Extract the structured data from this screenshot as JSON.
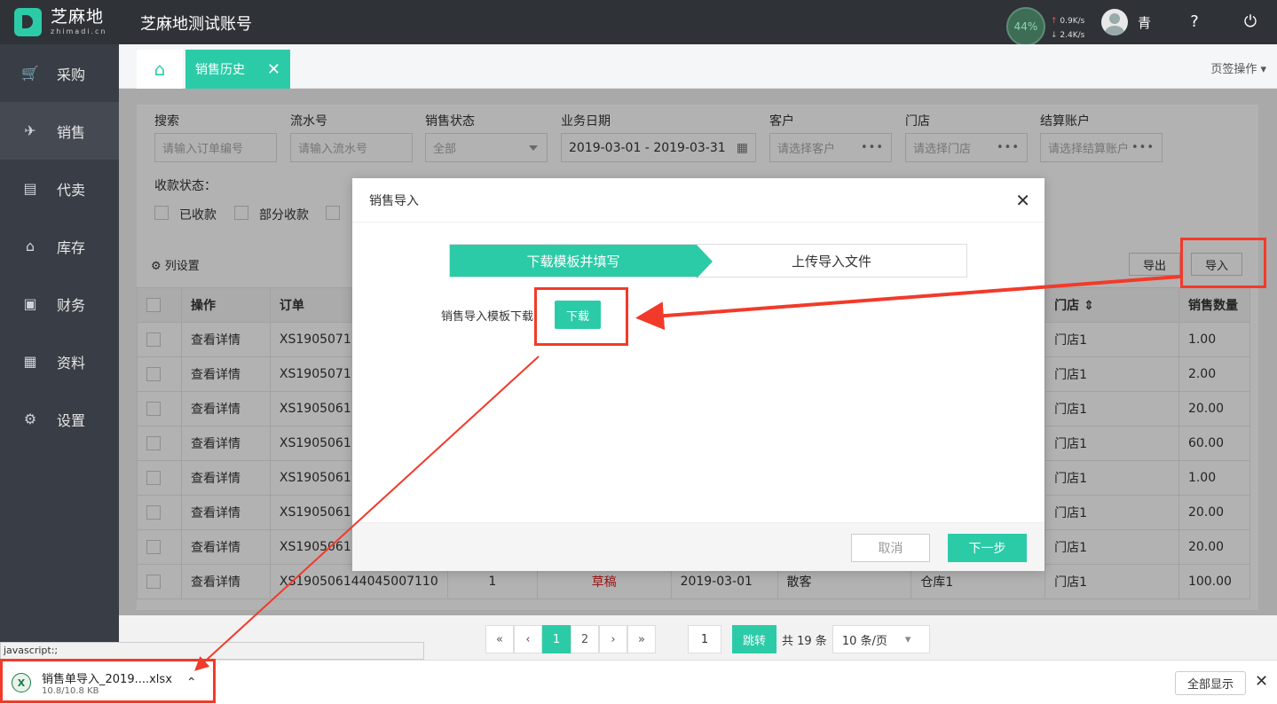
{
  "header": {
    "logo_cn": "芝麻地",
    "logo_en": "zhimadi.cn",
    "account": "芝麻地测试账号",
    "cpu": "44%",
    "up": "0.9K/s",
    "down": "2.4K/s",
    "user": "青"
  },
  "sidebar": {
    "items": [
      {
        "label": "采购",
        "icon": "cart-icon"
      },
      {
        "label": "销售",
        "icon": "sale-icon"
      },
      {
        "label": "代卖",
        "icon": "consign-icon"
      },
      {
        "label": "库存",
        "icon": "warehouse-icon"
      },
      {
        "label": "财务",
        "icon": "finance-icon"
      },
      {
        "label": "资料",
        "icon": "data-icon"
      },
      {
        "label": "设置",
        "icon": "gear-icon"
      }
    ]
  },
  "tabs": {
    "active": "销售历史",
    "ops": "页签操作"
  },
  "filters": {
    "search_label": "搜索",
    "search_ph": "请输入订单编号",
    "serial_label": "流水号",
    "serial_ph": "请输入流水号",
    "status_label": "销售状态",
    "status_val": "全部",
    "date_label": "业务日期",
    "date_val": "2019-03-01 - 2019-03-31",
    "customer_label": "客户",
    "customer_ph": "请选择客户",
    "store_label": "门店",
    "store_ph": "请选择门店",
    "account_label": "结算账户",
    "account_ph": "请选择结算账户",
    "pay_label": "收款状态：",
    "pay_opt1": "已收款",
    "pay_opt2": "部分收款"
  },
  "toolbar": {
    "col_settings": "列设置",
    "export": "导出",
    "import": "导入"
  },
  "table": {
    "headers": {
      "op": "操作",
      "order": "订单",
      "store": "门店",
      "qty": "销售数量"
    },
    "rows": [
      {
        "op": "查看详情",
        "order": "XS1905071",
        "store": "门店1",
        "qty": "1.00"
      },
      {
        "op": "查看详情",
        "order": "XS1905071",
        "store": "门店1",
        "qty": "2.00"
      },
      {
        "op": "查看详情",
        "order": "XS1905061",
        "store": "门店1",
        "qty": "20.00"
      },
      {
        "op": "查看详情",
        "order": "XS1905061",
        "store": "门店1",
        "qty": "60.00"
      },
      {
        "op": "查看详情",
        "order": "XS1905061",
        "store": "门店1",
        "qty": "1.00"
      },
      {
        "op": "查看详情",
        "order": "XS1905061",
        "store": "门店1",
        "qty": "20.00"
      },
      {
        "op": "查看详情",
        "order": "XS1905061",
        "store": "门店1",
        "qty": "20.00"
      },
      {
        "op": "查看详情",
        "order": "XS190506144045007110",
        "n": "1",
        "state": "草稿",
        "date": "2019-03-01",
        "customer": "散客",
        "warehouse": "仓库1",
        "store": "门店1",
        "qty": "100.00"
      }
    ]
  },
  "modal": {
    "title": "销售导入",
    "step1": "下载模板并填写",
    "step2": "上传导入文件",
    "dl_label": "销售导入模板下载",
    "dl_btn": "下载",
    "cancel": "取消",
    "next": "下一步"
  },
  "pager": {
    "p1": "1",
    "p2": "2",
    "page_input": "1",
    "jump": "跳转",
    "total": "共 19 条",
    "per_page": "10 条/页"
  },
  "download": {
    "status_url": "javascript:;",
    "file": "销售单导入_2019....xlsx",
    "size": "10.8/10.8 KB",
    "show_all": "全部显示"
  },
  "colors": {
    "accent": "#2ccba8",
    "annotation": "#f23a2a"
  }
}
